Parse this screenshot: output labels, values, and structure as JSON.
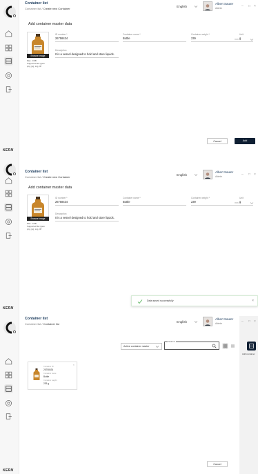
{
  "app": {
    "title": "Container list",
    "language": "English",
    "user": {
      "name": "Albert Sauter",
      "role": "Admin"
    },
    "brand": "KERN",
    "window_controls": [
      "–",
      "□",
      "×"
    ],
    "nav_icons": [
      "home-icon",
      "grid-icon",
      "list-icon",
      "globe-icon",
      "exit-icon"
    ]
  },
  "screens": [
    {
      "breadcrumb": [
        "Container list",
        "Create new Container"
      ],
      "page_title": "Add container master data",
      "image_button": "Browse image",
      "image_meta": [
        "Max. 2 MB",
        "Supported file types:",
        "png, jpg, svg, tiff"
      ],
      "fields": {
        "id_label": "ID number *",
        "id_value": "26758434",
        "name_label": "Container name *",
        "name_value": "Bottle",
        "weight_label": "Container weight *",
        "weight_value": "239",
        "weight_unit": "mm",
        "unit_label": "Unit",
        "unit_value": "g",
        "desc_label": "Description",
        "desc_value": "It is a vessel designed to hold and store liquids."
      },
      "cancel_label": "Cancel",
      "primary_label": "Add"
    },
    {
      "breadcrumb": [
        "Container list",
        "Create new Container"
      ],
      "page_title": "Add container master data",
      "image_button": "Browse image",
      "image_meta": [
        "Max. 2 MB",
        "Supported file types:",
        "png, jpg, svg, tiff"
      ],
      "fields": {
        "id_label": "ID number *",
        "id_value": "26758434",
        "name_label": "Container name *",
        "name_value": "Bottle",
        "weight_label": "Container weight *",
        "weight_value": "239",
        "weight_unit": "mm",
        "unit_label": "Unit",
        "unit_value": "g",
        "desc_label": "Description",
        "desc_value": "It is a vessel designed to hold and store liquids."
      },
      "toast": "Data saved successfully"
    },
    {
      "breadcrumb": [
        "Container list",
        "Container list"
      ],
      "filter_value": "Active container master",
      "search_label": "Search",
      "add_container_label": "Add container",
      "tile": {
        "id_label": "Container ID",
        "id_value": "26758434",
        "name_label": "Container name",
        "name_value": "Bottle",
        "weight_label": "Container weight",
        "weight_value": "239 g"
      },
      "cancel_label": "Cancel"
    }
  ]
}
